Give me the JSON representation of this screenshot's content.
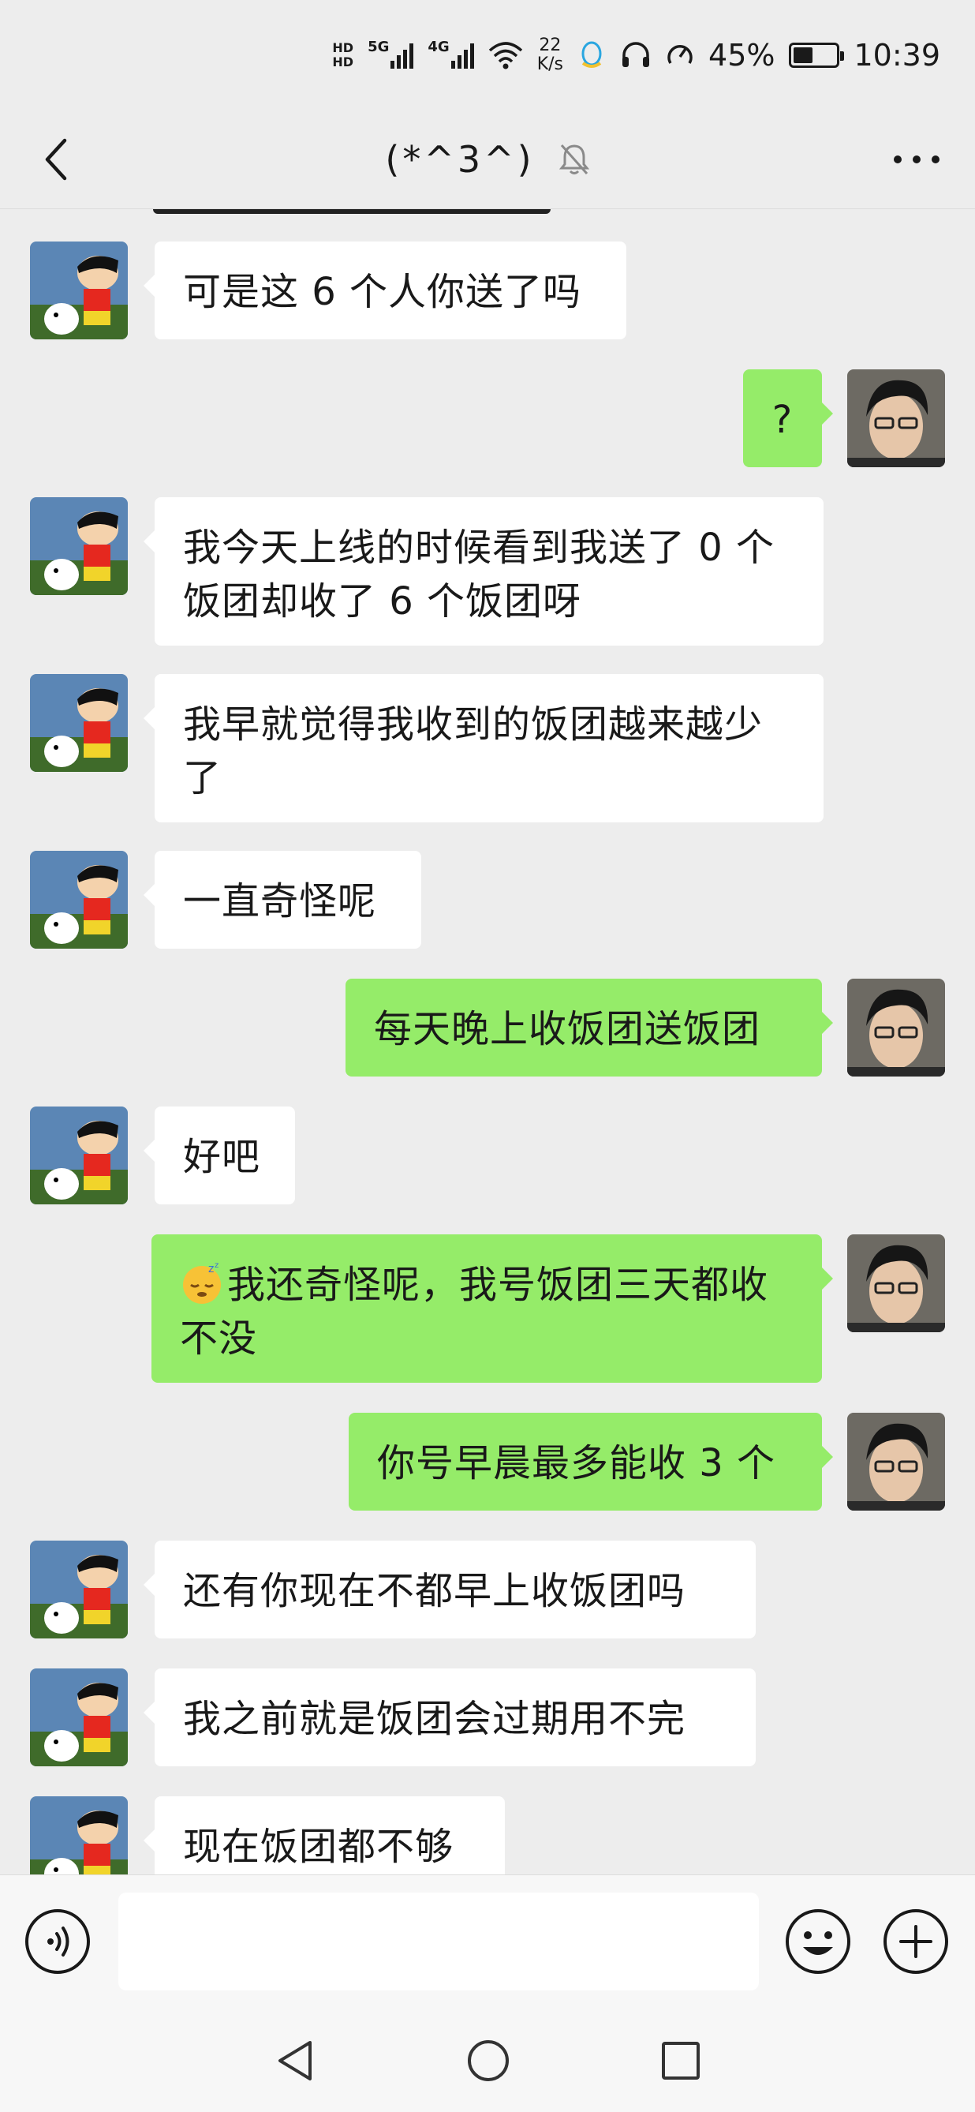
{
  "status_bar": {
    "hd1": "HD",
    "hd2": "HD",
    "net1": "5G",
    "net2": "4G",
    "speed_value": "22",
    "speed_unit": "K/s",
    "battery": "45%",
    "battery_level": 0.45,
    "time": "10:39"
  },
  "header": {
    "title": "(*^3^)",
    "icons": [
      "back-icon",
      "mute-bell-icon",
      "more-icon"
    ]
  },
  "messages": [
    {
      "side": "in",
      "text": "可是这 6 个人你送了吗"
    },
    {
      "side": "out",
      "text": "?"
    },
    {
      "side": "in",
      "text": "我今天上线的时候看到我送了 0 个饭团却收了 6 个饭团呀"
    },
    {
      "side": "in",
      "text": "我早就觉得我收到的饭团越来越少了"
    },
    {
      "side": "in",
      "text": "一直奇怪呢"
    },
    {
      "side": "out",
      "text": "每天晚上收饭团送饭团"
    },
    {
      "side": "in",
      "text": "好吧"
    },
    {
      "side": "out",
      "text": "我还奇怪呢，我号饭团三天都收不没",
      "emoji": "sleepy-face-emoji"
    },
    {
      "side": "out",
      "text": "你号早晨最多能收 3 个"
    },
    {
      "side": "in",
      "text": "还有你现在不都早上收饭团吗"
    },
    {
      "side": "in",
      "text": "我之前就是饭团会过期用不完"
    },
    {
      "side": "in",
      "text": "现在饭团都不够"
    }
  ],
  "input_bar": {
    "value": "",
    "icons": [
      "voice-icon",
      "emoji-icon",
      "plus-icon"
    ]
  },
  "system_nav": {
    "icons": [
      "nav-back-icon",
      "nav-home-icon",
      "nav-recents-icon"
    ]
  },
  "colors": {
    "background": "#ededed",
    "incoming_bubble": "#ffffff",
    "outgoing_bubble": "#95ec69",
    "text": "#191919"
  }
}
